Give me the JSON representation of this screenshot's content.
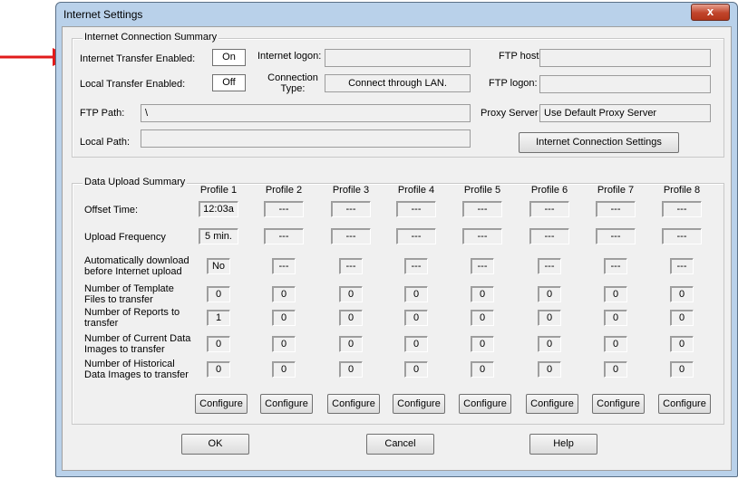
{
  "window": {
    "title": "Internet Settings",
    "close_glyph": "x"
  },
  "connection": {
    "group_title": "Internet Connection Summary",
    "transfer_label": "Internet Transfer Enabled:",
    "transfer_value": "On",
    "local_label": "Local Transfer Enabled:",
    "local_value": "Off",
    "logon_label": "Internet logon:",
    "logon_value": "",
    "conn_type_label": "Connection Type:",
    "conn_type_value": "Connect through LAN.",
    "ftp_host_label": "FTP host:",
    "ftp_host_value": "",
    "ftp_logon_label": "FTP logon:",
    "ftp_logon_value": "",
    "ftp_path_label": "FTP Path:",
    "ftp_path_value": "\\",
    "proxy_label": "Proxy Server",
    "proxy_value": "Use Default Proxy Server",
    "local_path_label": "Local Path:",
    "local_path_value": "",
    "settings_button": "Internet Connection Settings"
  },
  "upload": {
    "group_title": "Data Upload Summary",
    "profiles": [
      "Profile 1",
      "Profile 2",
      "Profile 3",
      "Profile 4",
      "Profile 5",
      "Profile 6",
      "Profile 7",
      "Profile 8"
    ],
    "rows": [
      {
        "label": "Offset Time:",
        "values": [
          "12:03a",
          "---",
          "---",
          "---",
          "---",
          "---",
          "---",
          "---"
        ]
      },
      {
        "label": "Upload Frequency",
        "values": [
          "5 min.",
          "---",
          "---",
          "---",
          "---",
          "---",
          "---",
          "---"
        ]
      },
      {
        "label": "Automatically download before Internet upload",
        "values": [
          "No",
          "---",
          "---",
          "---",
          "---",
          "---",
          "---",
          "---"
        ]
      },
      {
        "label": "Number of Template Files to transfer",
        "values": [
          "0",
          "0",
          "0",
          "0",
          "0",
          "0",
          "0",
          "0"
        ]
      },
      {
        "label": "Number of Reports to transfer",
        "values": [
          "1",
          "0",
          "0",
          "0",
          "0",
          "0",
          "0",
          "0"
        ]
      },
      {
        "label": "Number of Current Data Images to transfer",
        "values": [
          "0",
          "0",
          "0",
          "0",
          "0",
          "0",
          "0",
          "0"
        ]
      },
      {
        "label": "Number of Historical Data Images to transfer",
        "values": [
          "0",
          "0",
          "0",
          "0",
          "0",
          "0",
          "0",
          "0"
        ]
      }
    ],
    "configure_label": "Configure"
  },
  "buttons": {
    "ok": "OK",
    "cancel": "Cancel",
    "help": "Help"
  },
  "colors": {
    "arrow": "#e11b1b",
    "window_frame": "#b9d1ea",
    "close_button": "#c1442a"
  }
}
